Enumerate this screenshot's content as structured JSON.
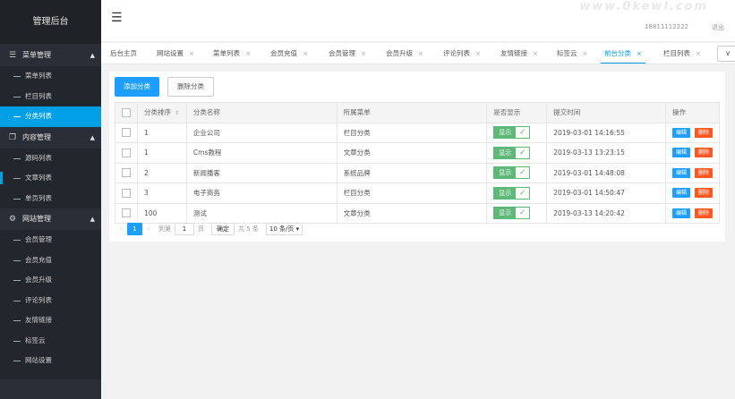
{
  "sidebar": {
    "title": "管理后台",
    "groups": [
      {
        "label": "菜单管理",
        "items": [
          "菜单列表",
          "栏目列表",
          "分类列表"
        ]
      },
      {
        "label": "内容管理",
        "items": [
          "源码列表",
          "文章列表",
          "单页列表"
        ]
      },
      {
        "label": "网站管理",
        "items": [
          "会员管理",
          "会员充值",
          "会员升级",
          "评论列表",
          "友情链接",
          "标签云",
          "网站设置"
        ]
      }
    ]
  },
  "header": {
    "menu_icon": "☰",
    "watermark": "www.0kewl.com",
    "phone": "18811112222",
    "logout": "退出"
  },
  "tabs": {
    "items": [
      "后台主页",
      "网站设置",
      "菜单列表",
      "会员充值",
      "会员管理",
      "会员升级",
      "评论列表",
      "友情链接",
      "标签云",
      "前台分类",
      "栏目列表"
    ],
    "close": "×",
    "more": "∨"
  },
  "toolbar": {
    "add": "添加分类",
    "delete": "删除分类"
  },
  "table": {
    "headers": [
      "分类排序",
      "分类名称",
      "所属菜单",
      "是否显示",
      "提交时间",
      "操作"
    ],
    "rows": [
      {
        "sort": "1",
        "name": "企业公司",
        "menu": "栏目分类",
        "show": "显示",
        "time": "2019-03-01 14:16:55"
      },
      {
        "sort": "1",
        "name": "Cms教程",
        "menu": "文章分类",
        "show": "显示",
        "time": "2019-03-13 13:23:15"
      },
      {
        "sort": "2",
        "name": "新闻播客",
        "menu": "系统品牌",
        "show": "显示",
        "time": "2019-03-01 14:48:08"
      },
      {
        "sort": "3",
        "name": "电子商务",
        "menu": "栏目分类",
        "show": "显示",
        "time": "2019-03-01 14:50:47"
      },
      {
        "sort": "100",
        "name": "测试",
        "menu": "文章分类",
        "show": "显示",
        "time": "2019-03-13 14:20:42"
      }
    ],
    "edit": "编辑",
    "del": "删除"
  },
  "pager": {
    "current": "1",
    "goto": "到第",
    "page_input": "1",
    "page_unit": "页",
    "confirm": "确定",
    "total": "共 5 条",
    "per_page": "10 条/页"
  },
  "colors": {
    "accent": "#009fe6",
    "primary": "#1e9fff",
    "success": "#5fb878",
    "danger": "#ff5722",
    "sidebar": "#22262d"
  }
}
